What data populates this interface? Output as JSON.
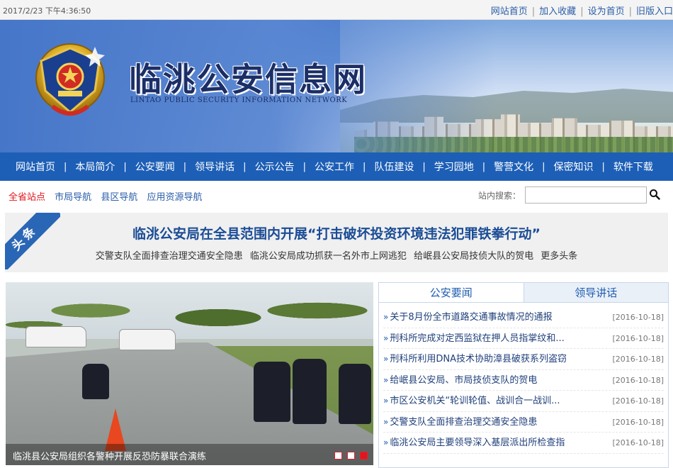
{
  "topbar": {
    "datetime": "2017/2/23 下午4:36:50",
    "links": [
      "网站首页",
      "加入收藏",
      "设为首页",
      "旧版入口"
    ]
  },
  "banner": {
    "title": "临洮公安信息网",
    "subtitle": "LINTAO PUBLIC SECURITY INFORMATION NETWORK",
    "emblem_icon": "police-emblem-icon"
  },
  "nav": {
    "items": [
      "网站首页",
      "本局简介",
      "公安要闻",
      "领导讲话",
      "公示公告",
      "公安工作",
      "队伍建设",
      "学习园地",
      "警营文化",
      "保密知识",
      "软件下载"
    ]
  },
  "subnav": {
    "links": [
      "全省站点",
      "市局导航",
      "县区导航",
      "应用资源导航"
    ],
    "search_label": "站内搜索：",
    "search_value": "",
    "search_icon": "search-icon"
  },
  "headline": {
    "ribbon": "头条",
    "main": "临洮公安局在全县范围内开展“打击破坏投资环境违法犯罪铁拳行动”",
    "sub_links": [
      "交警支队全面排查治理交通安全隐患",
      "临洮公安局成功抓获一名外市上网逃犯",
      "给岷县公安局技侦大队的贺电",
      "更多头条"
    ]
  },
  "slideshow": {
    "caption": "临洮县公安局组织各警种开展反恐防暴联合演练",
    "dots": [
      false,
      false,
      true
    ]
  },
  "news_panel": {
    "tabs": [
      "公安要闻",
      "领导讲话"
    ],
    "active_tab": 0,
    "items": [
      {
        "title": "关于8月份全市道路交通事故情况的通报",
        "date": "[2016-10-18]"
      },
      {
        "title": "刑科所完成对定西监狱在押人员指掌纹和...",
        "date": "[2016-10-18]"
      },
      {
        "title": "刑科所利用DNA技术协助漳县破获系列盗窃",
        "date": "[2016-10-18]"
      },
      {
        "title": "给岷县公安局、市局技侦支队的贺电",
        "date": "[2016-10-18]"
      },
      {
        "title": "市区公安机关“轮训轮值、战训合一战训...",
        "date": "[2016-10-18]"
      },
      {
        "title": "交警支队全面排查治理交通安全隐患",
        "date": "[2016-10-18]"
      },
      {
        "title": "临洮公安局主要领导深入基层派出所检查指",
        "date": "[2016-10-18]"
      }
    ]
  },
  "colors": {
    "nav_blue": "#1d5fb6",
    "link_blue": "#2a5da8",
    "hot_red": "#e0161c",
    "headline_blue": "#1a4c95"
  }
}
